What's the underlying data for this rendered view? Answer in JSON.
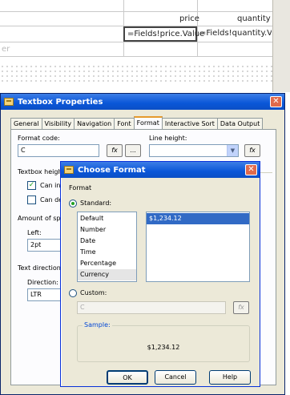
{
  "report": {
    "header_price": "price",
    "header_quantity": "quantity",
    "cell_price_expr": "=Fields!price.Value",
    "cell_quantity_expr": "=Fields!quantity.Va",
    "placeholder_row_text": "er"
  },
  "textbox_properties": {
    "title": "Textbox Properties",
    "tabs": [
      "General",
      "Visibility",
      "Navigation",
      "Font",
      "Format",
      "Interactive Sort",
      "Data Output"
    ],
    "active_tab": "Format",
    "format_code_label": "Format code:",
    "format_code_value": "C",
    "expr_button": "fx",
    "ellipsis_button": "...",
    "line_height_label": "Line height:",
    "line_height_value": "",
    "textbox_height_label": "Textbox heigh",
    "can_increase_label": "Can inc",
    "can_increase_checked": true,
    "can_decrease_label": "Can de",
    "can_decrease_checked": false,
    "amount_spacing_label": "Amount of spa",
    "left_label": "Left:",
    "left_value": "2pt",
    "text_direction_label": "Text direction",
    "direction_label": "Direction:",
    "direction_value": "LTR"
  },
  "choose_format": {
    "title": "Choose Format",
    "format_label": "Format",
    "standard_label": "Standard:",
    "standard_selected": true,
    "standard_options": [
      "Default",
      "Number",
      "Date",
      "Time",
      "Percentage",
      "Currency"
    ],
    "standard_focused": "Currency",
    "preview_options": [
      "$1,234.12"
    ],
    "preview_selected": "$1,234.12",
    "custom_label": "Custom:",
    "custom_value": "C",
    "expr_button": "fx",
    "sample_label": "Sample:",
    "sample_value": "$1,234.12",
    "ok_label": "OK",
    "cancel_label": "Cancel",
    "help_label": "Help"
  }
}
